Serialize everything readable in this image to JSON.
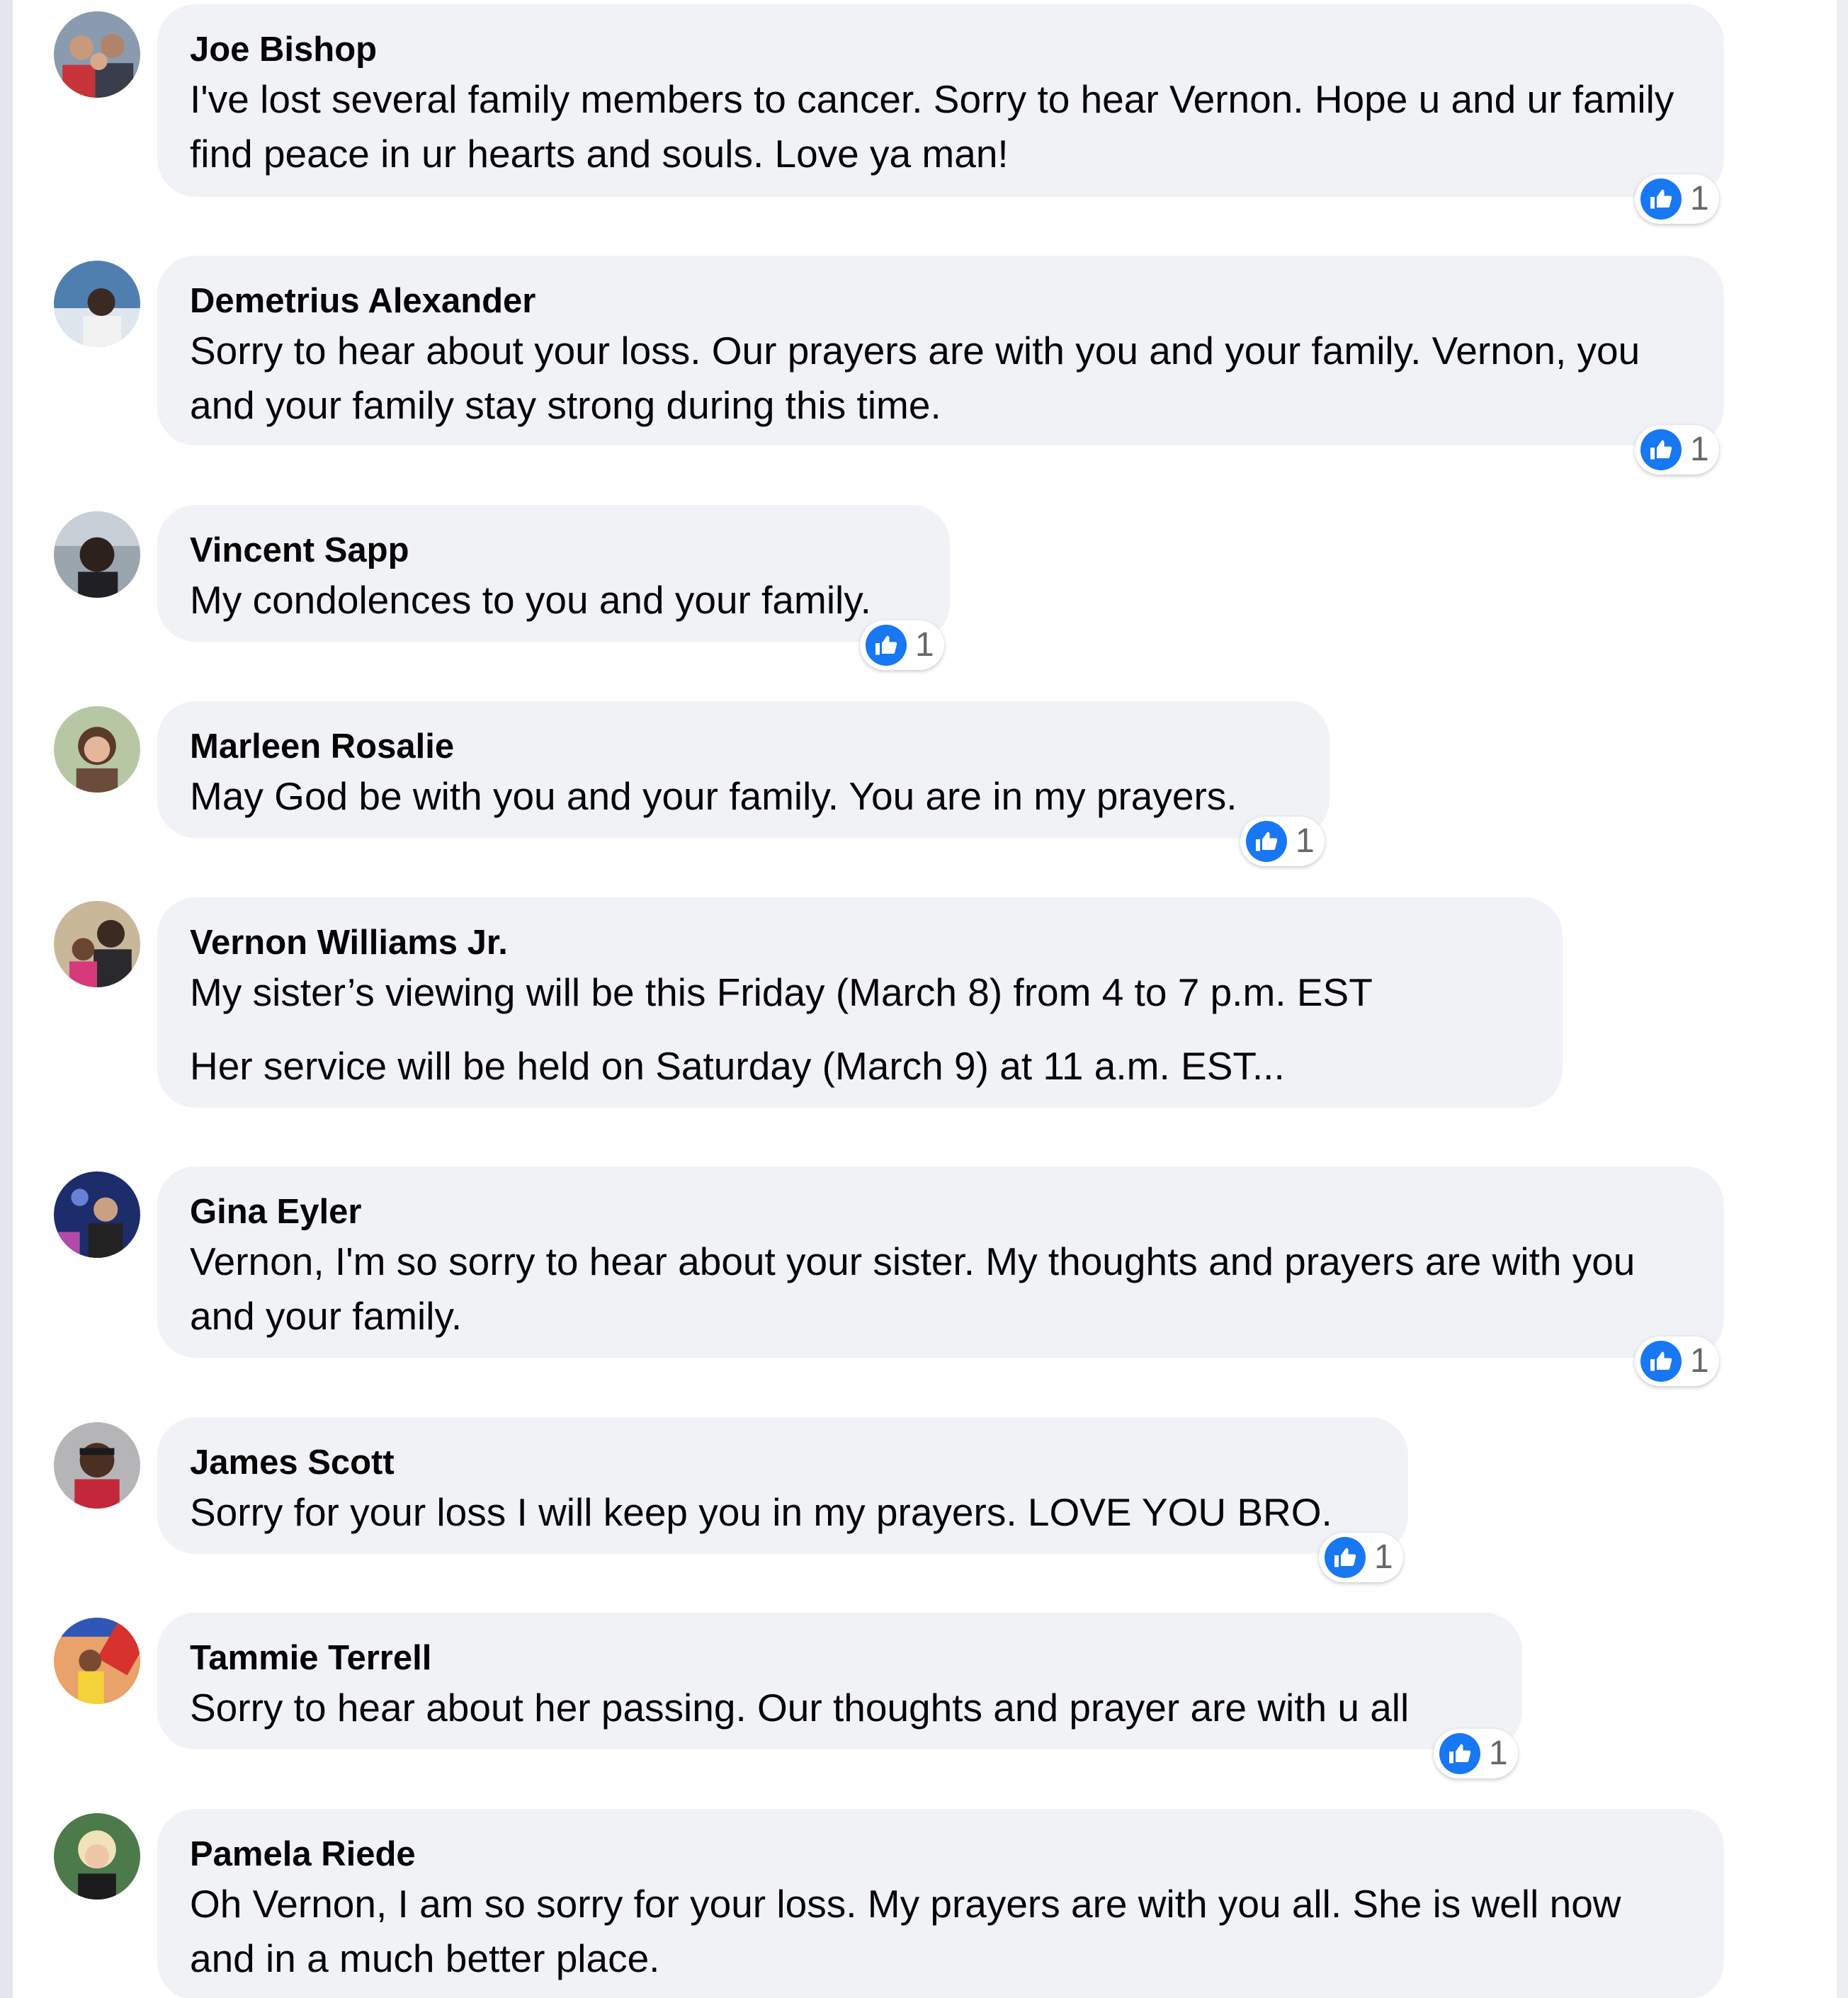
{
  "colors": {
    "bubble": "#f0f2f5",
    "like_blue": "#1877f2",
    "text": "#050505",
    "secondary_text": "#65676b"
  },
  "comments": [
    {
      "author": "Joe Bishop",
      "lines": [
        "I've lost several family members to cancer. Sorry to hear Vernon. Hope u and ur family find peace in ur hearts and souls. Love ya man!"
      ],
      "reaction_icon": "like-icon",
      "reaction_count": "1"
    },
    {
      "author": "Demetrius Alexander",
      "lines": [
        "Sorry to hear about your loss. Our prayers are with you and your family. Vernon, you and your family stay strong during this time."
      ],
      "reaction_icon": "like-icon",
      "reaction_count": "1"
    },
    {
      "author": "Vincent Sapp",
      "lines": [
        "My condolences to you and your family."
      ],
      "reaction_icon": "like-icon",
      "reaction_count": "1"
    },
    {
      "author": "Marleen Rosalie",
      "lines": [
        "May God be with you and your family. You are in my prayers."
      ],
      "reaction_icon": "like-icon",
      "reaction_count": "1"
    },
    {
      "author": "Vernon Williams Jr.",
      "lines": [
        "My sister’s viewing will be this Friday (March 8) from 4 to 7 p.m. EST",
        "Her service will be held on Saturday (March 9) at 11 a.m. EST..."
      ]
    },
    {
      "author": "Gina Eyler",
      "lines": [
        "Vernon, I'm so sorry to hear about your sister. My thoughts and prayers are with you and your family."
      ],
      "reaction_icon": "like-icon",
      "reaction_count": "1"
    },
    {
      "author": "James Scott",
      "lines": [
        "Sorry for your loss I will keep you in my prayers. LOVE YOU BRO."
      ],
      "reaction_icon": "like-icon",
      "reaction_count": "1"
    },
    {
      "author": "Tammie Terrell",
      "lines": [
        "Sorry to hear about her passing. Our thoughts and prayer are with u all"
      ],
      "reaction_icon": "like-icon",
      "reaction_count": "1"
    },
    {
      "author": "Pamela Riede",
      "lines": [
        "Oh Vernon, I am so sorry for your loss. My prayers are with you all. She is well now and in a much better place."
      ]
    }
  ]
}
